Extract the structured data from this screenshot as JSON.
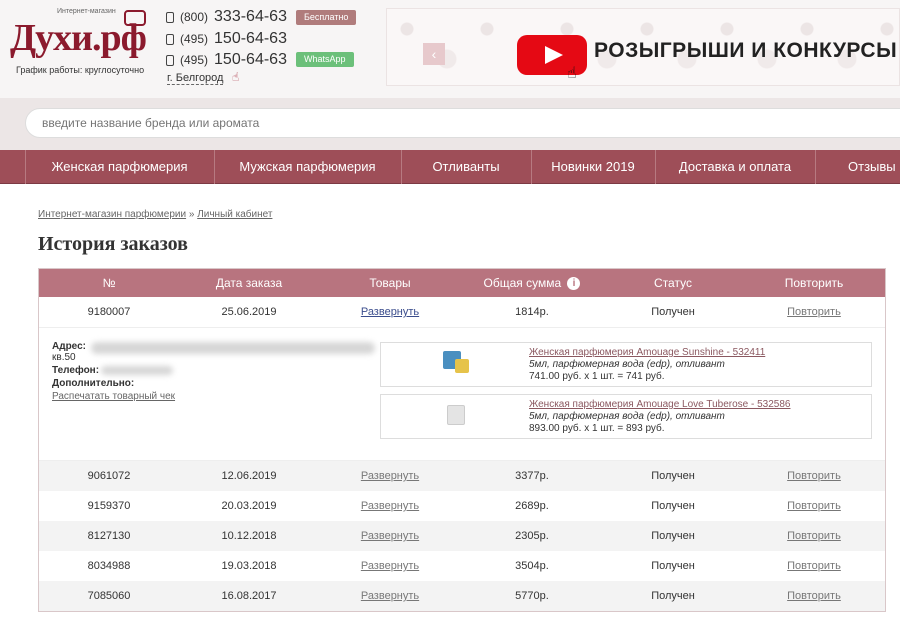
{
  "header": {
    "logo_small": "Интернет-магазин",
    "logo_text": "Духи.рф",
    "schedule": "График работы: круглосуточно",
    "phones": [
      {
        "code": "(800)",
        "number": "333-64-63"
      },
      {
        "code": "(495)",
        "number": "150-64-63"
      },
      {
        "code": "(495)",
        "number": "150-64-63"
      }
    ],
    "tag_free": "Бесплатно",
    "tag_whatsapp": "WhatsApp",
    "city": "г. Белгород",
    "banner_text": "РОЗЫГРЫШИ И КОНКУРСЫ",
    "banner_prev": "‹"
  },
  "search": {
    "placeholder": "введите название бренда или аромата"
  },
  "nav": {
    "items": [
      "Женская парфюмерия",
      "Мужская парфюмерия",
      "Отливанты",
      "Новинки 2019",
      "Доставка и оплата",
      "Отзывы"
    ]
  },
  "breadcrumb": {
    "home": "Интернет-магазин парфюмерии",
    "sep": "»",
    "current": "Личный кабинет"
  },
  "page_title": "История заказов",
  "table": {
    "headers": [
      "№",
      "Дата заказа",
      "Товары",
      "Общая сумма",
      "Статус",
      "Повторить"
    ],
    "info_icon": "i",
    "rows": [
      {
        "num": "9180007",
        "date": "25.06.2019",
        "goods": "Развернуть",
        "sum": "1814р.",
        "status": "Получен",
        "repeat": "Повторить"
      },
      {
        "num": "9061072",
        "date": "12.06.2019",
        "goods": "Развернуть",
        "sum": "3377р.",
        "status": "Получен",
        "repeat": "Повторить"
      },
      {
        "num": "9159370",
        "date": "20.03.2019",
        "goods": "Развернуть",
        "sum": "2689р.",
        "status": "Получен",
        "repeat": "Повторить"
      },
      {
        "num": "8127130",
        "date": "10.12.2018",
        "goods": "Развернуть",
        "sum": "2305р.",
        "status": "Получен",
        "repeat": "Повторить"
      },
      {
        "num": "8034988",
        "date": "19.03.2018",
        "goods": "Развернуть",
        "sum": "3504р.",
        "status": "Получен",
        "repeat": "Повторить"
      },
      {
        "num": "7085060",
        "date": "16.08.2017",
        "goods": "Развернуть",
        "sum": "5770р.",
        "status": "Получен",
        "repeat": "Повторить"
      }
    ]
  },
  "details": {
    "address_label": "Адрес:",
    "address_tail": "кв.50",
    "phone_label": "Телефон:",
    "extra_label": "Дополнительно:",
    "print_link": "Распечатать товарный чек",
    "products": [
      {
        "title": "Женская парфюмерия Amouage Sunshine - 532411",
        "sub": "5мл, парфюмерная вода (edp), отливант",
        "price": "741.00 руб. x 1 шт. = 741 руб."
      },
      {
        "title": "Женская парфюмерия Amouage Love Tuberose - 532586",
        "sub": "5мл, парфюмерная вода (edp), отливант",
        "price": "893.00 руб. x 1 шт. = 893 руб."
      }
    ]
  },
  "colors": {
    "brand": "#8b1a2d",
    "nav_bg": "#9e4e58",
    "table_header_bg": "#b8747f"
  }
}
